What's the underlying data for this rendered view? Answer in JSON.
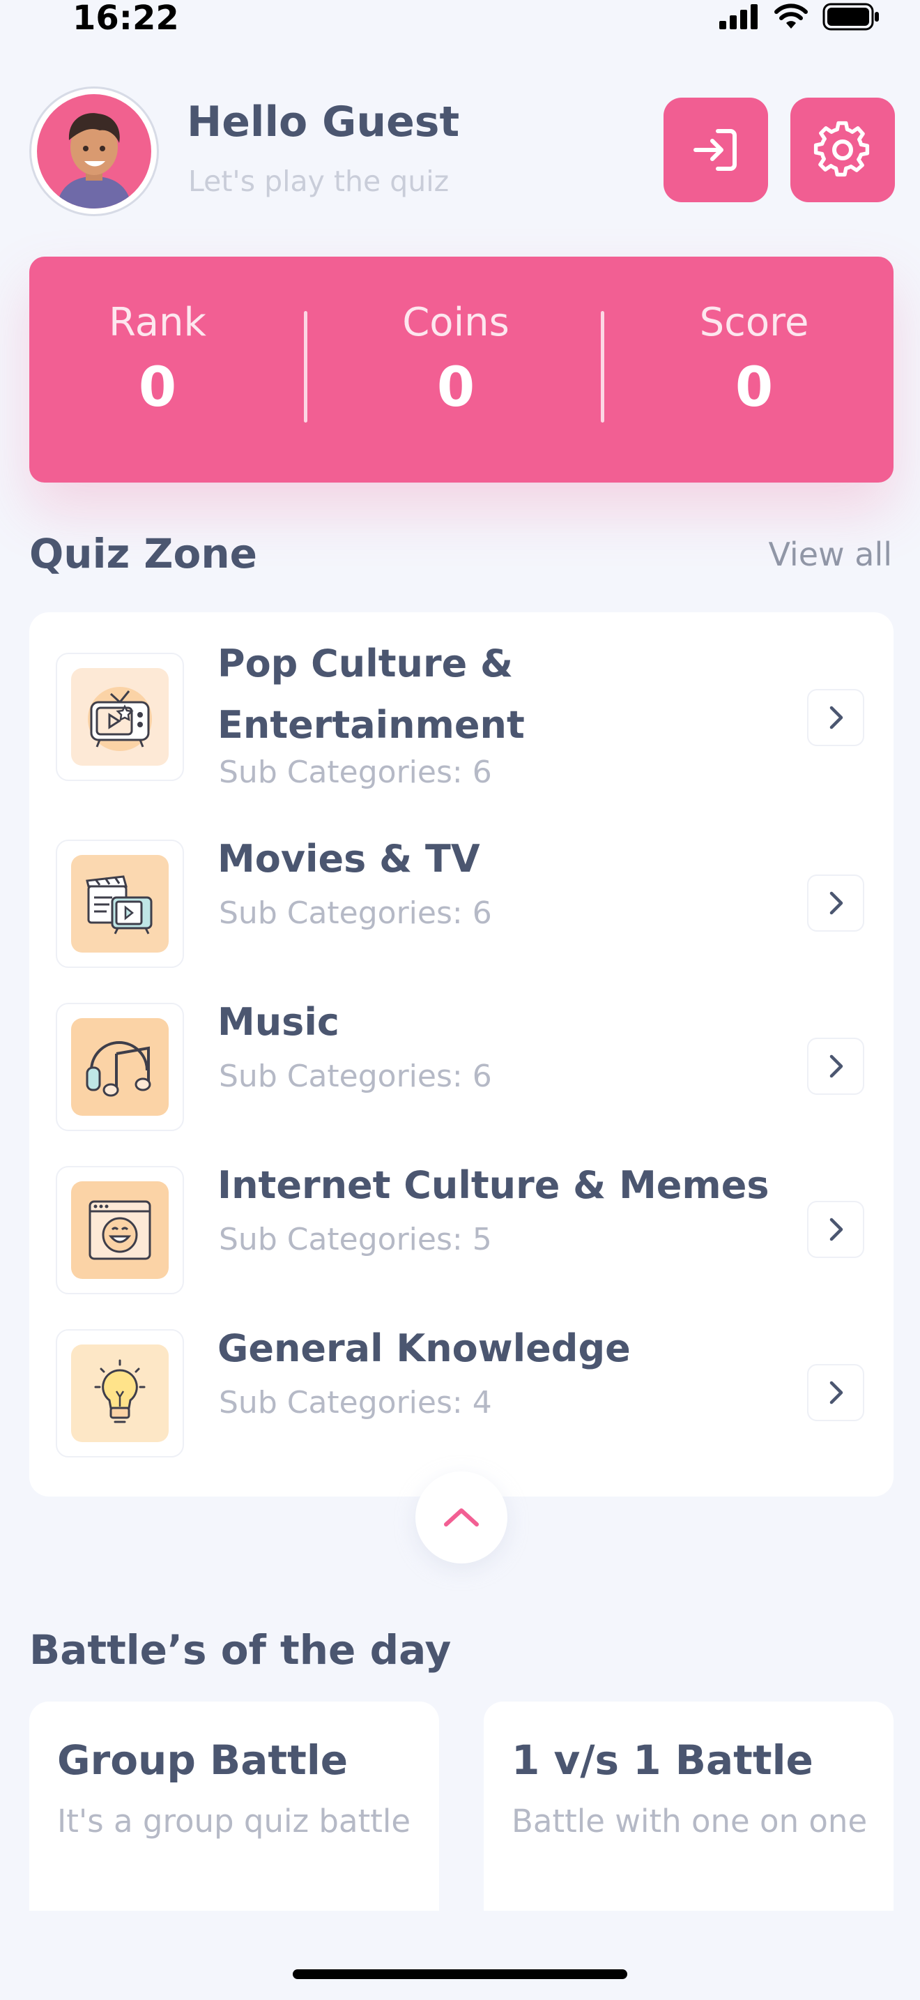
{
  "status": {
    "time": "16:22"
  },
  "header": {
    "greeting": "Hello Guest",
    "subtitle": "Let's play the quiz"
  },
  "stats": [
    {
      "label": "Rank",
      "value": "0"
    },
    {
      "label": "Coins",
      "value": "0"
    },
    {
      "label": "Score",
      "value": "0"
    }
  ],
  "quiz_zone": {
    "title": "Quiz Zone",
    "view_all": "View all",
    "items": [
      {
        "title": "Pop Culture & Entertainment",
        "sub": "Sub Categories: 6",
        "icon": "tv-star-icon"
      },
      {
        "title": "Movies & TV",
        "sub": "Sub Categories: 6",
        "icon": "clapperboard-tv-icon"
      },
      {
        "title": "Music",
        "sub": "Sub Categories: 6",
        "icon": "headphones-music-icon"
      },
      {
        "title": "Internet Culture & Memes",
        "sub": "Sub Categories: 5",
        "icon": "laughing-browser-icon"
      },
      {
        "title": "General Knowledge",
        "sub": "Sub Categories: 4",
        "icon": "lightbulb-icon"
      }
    ]
  },
  "battles": {
    "title": "Battle’s of the day",
    "cards": [
      {
        "title": "Group Battle",
        "desc": "It's a group quiz battle"
      },
      {
        "title": "1 v/s 1 Battle",
        "desc": "Battle with one on one"
      }
    ]
  },
  "colors": {
    "accent": "#f25f93",
    "text": "#4b5670",
    "muted": "#b5b9c6",
    "background": "#f4f6fc"
  }
}
